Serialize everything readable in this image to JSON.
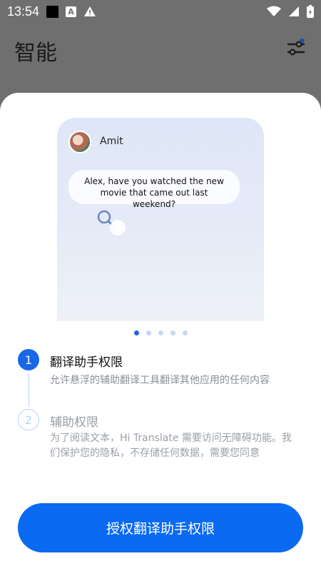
{
  "status_bar": {
    "time": "13:54",
    "icons": [
      "black-square-icon",
      "a-notification-icon",
      "warning-icon",
      "wifi-icon",
      "signal-icon",
      "battery-icon"
    ]
  },
  "header": {
    "title": "智能",
    "filter_icon": "filter-settings-icon"
  },
  "preview": {
    "contact_name": "Amit",
    "message": "Alex, have you watched the new movie that came out last weekend?"
  },
  "carousel": {
    "count": 5,
    "active": 0
  },
  "steps": [
    {
      "number": "1",
      "title": "翻译助手权限",
      "description": "允许悬浮的辅助翻译工具翻译其他应用的任何内容"
    },
    {
      "number": "2",
      "title": "辅助权限",
      "description": "为了阅读文本，Hi Translate 需要访问无障碍功能。我们保护您的隐私，不存储任何数据，需要您同意"
    }
  ],
  "primary_button": {
    "label": "授权翻译助手权限"
  },
  "colors": {
    "accent": "#0a6af2",
    "header_bg": "#6f6f6f"
  }
}
